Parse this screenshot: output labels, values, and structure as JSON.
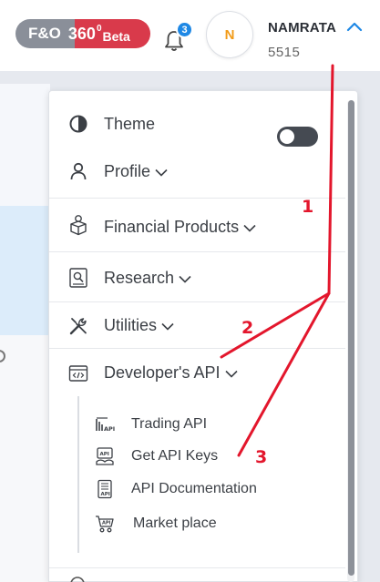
{
  "header": {
    "fo_badge": {
      "prefix": "F&O",
      "number": "360",
      "superscript": "0",
      "suffix": "Beta"
    },
    "notifications_count": "3",
    "avatar_initial": "N",
    "user_name": "NAMRATA",
    "user_id": "5515"
  },
  "menu": {
    "theme_label": "Theme",
    "theme_toggle_on": false,
    "items": [
      {
        "label": "Profile",
        "icon": "user-icon"
      },
      {
        "label": "Financial Products",
        "icon": "product-box-icon"
      },
      {
        "label": "Research",
        "icon": "research-doc-icon"
      },
      {
        "label": "Utilities",
        "icon": "tools-icon"
      },
      {
        "label": "Developer's API",
        "icon": "code-window-icon"
      }
    ],
    "developer_api_submenu": [
      {
        "label": "Trading API",
        "icon": "trading-api-icon"
      },
      {
        "label": "Get API Keys",
        "icon": "api-key-icon"
      },
      {
        "label": "API Documentation",
        "icon": "api-doc-icon"
      },
      {
        "label": "Market place",
        "icon": "api-cart-icon"
      }
    ]
  },
  "annotations": [
    "1",
    "2",
    "3"
  ],
  "colors": {
    "annotation_red": "#e3162c",
    "badge_grey": "#8a8f99",
    "badge_red": "#d93a4b",
    "notification_blue": "#1e88e5",
    "avatar_orange": "#f29b18"
  }
}
